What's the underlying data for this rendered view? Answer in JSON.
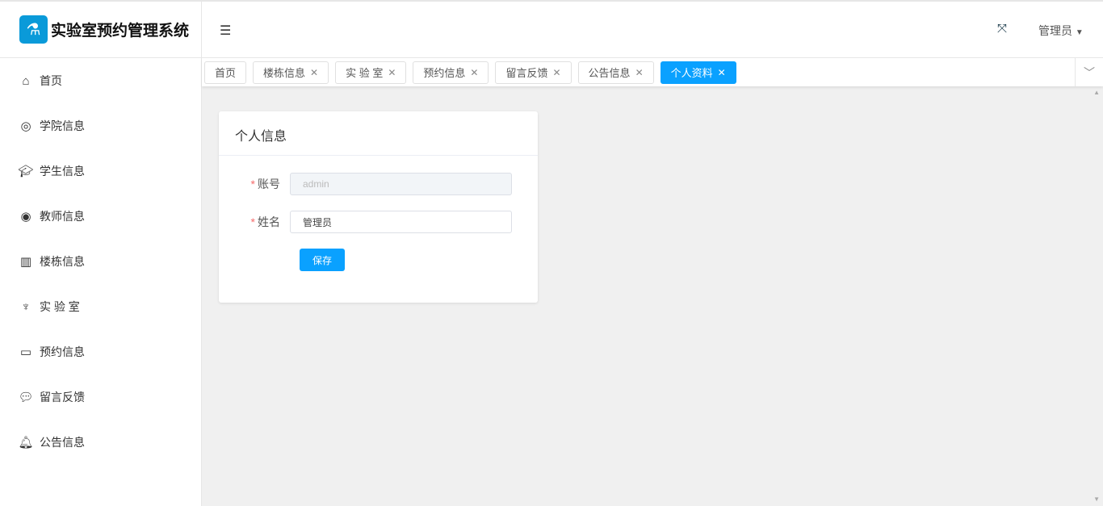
{
  "app": {
    "title": "实验室预约管理系统"
  },
  "sidebar": {
    "items": [
      {
        "label": "首页",
        "icon": "home-icon"
      },
      {
        "label": "学院信息",
        "icon": "instagram-icon"
      },
      {
        "label": "学生信息",
        "icon": "graduation-cap-icon"
      },
      {
        "label": "教师信息",
        "icon": "user-circle-icon"
      },
      {
        "label": "楼栋信息",
        "icon": "building-icon"
      },
      {
        "label": "实 验 室",
        "icon": "lab-icon"
      },
      {
        "label": "预约信息",
        "icon": "id-card-icon"
      },
      {
        "label": "留言反馈",
        "icon": "comment-icon"
      },
      {
        "label": "公告信息",
        "icon": "bell-icon"
      }
    ]
  },
  "header": {
    "user": "管理员"
  },
  "tabs": [
    {
      "label": "首页"
    },
    {
      "label": "楼栋信息"
    },
    {
      "label": "实 验 室"
    },
    {
      "label": "预约信息"
    },
    {
      "label": "留言反馈"
    },
    {
      "label": "公告信息"
    },
    {
      "label": "个人资料"
    }
  ],
  "card": {
    "title": "个人信息",
    "account_label": "账号",
    "account_value": "admin",
    "name_label": "姓名",
    "name_value": "管理员",
    "save": "保存"
  },
  "colors": {
    "accent": "#0aa1ff",
    "logo": "#0a9ad9"
  }
}
